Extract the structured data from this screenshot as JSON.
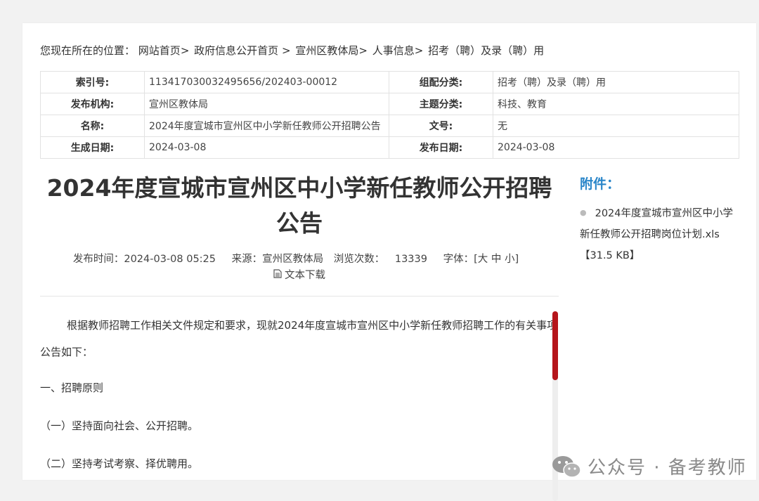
{
  "breadcrumb": {
    "prefix": "您现在所在的位置：",
    "items": [
      "网站首页",
      "政府信息公开首页",
      "宣州区教体局",
      "人事信息",
      "招考（聘）及录（聘）用"
    ]
  },
  "meta": {
    "index_label": "索引号:",
    "index_value": "113417030032495656/202403-00012",
    "category_label": "组配分类:",
    "category_value": "招考（聘）及录（聘）用",
    "publisher_label": "发布机构:",
    "publisher_value": "宣州区教体局",
    "topic_label": "主题分类:",
    "topic_value": "科技、教育",
    "name_label": "名称:",
    "name_value": "2024年度宣城市宣州区中小学新任教师公开招聘公告",
    "docno_label": "文号:",
    "docno_value": "无",
    "created_label": "生成日期:",
    "created_value": "2024-03-08",
    "pubdate_label": "发布日期:",
    "pubdate_value": "2024-03-08"
  },
  "article": {
    "title": "2024年度宣城市宣州区中小学新任教师公开招聘公告",
    "publish_time": "发布时间：2024-03-08 05:25",
    "source": "来源：宣州区教体局",
    "views_label": "浏览次数：",
    "views": "13339",
    "font_label": "字体：[",
    "font_large": "大",
    "font_medium": "中",
    "font_small": "小",
    "font_close": "]",
    "download_label": "文本下载",
    "paragraphs": [
      "根据教师招聘工作相关文件规定和要求，现就2024年度宣城市宣州区中小学新任教师招聘工作的有关事项公告如下：",
      "一、招聘原则",
      "（一）坚持面向社会、公开招聘。",
      "（二）坚持考试考察、择优聘用。"
    ]
  },
  "attachments": {
    "title": "附件：",
    "items": [
      "2024年度宣城市宣州区中小学新任教师公开招聘岗位计划.xls【31.5 KB】"
    ]
  },
  "watermark": {
    "text": "公众号 · 备考教师"
  },
  "colors": {
    "accent_blue": "#2a86c9",
    "scroll_thumb": "#b5151b"
  }
}
